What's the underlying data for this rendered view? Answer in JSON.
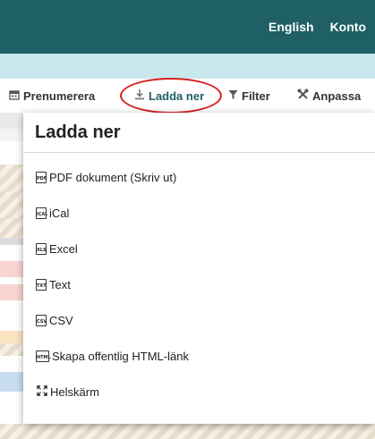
{
  "topbar": {
    "links": [
      "English",
      "Konto"
    ],
    "bg_color": "#1f5f66",
    "subbar_color": "#c9e8ee"
  },
  "toolbar": {
    "items": [
      {
        "label": "Prenumerera",
        "icon": "calendar-icon"
      },
      {
        "label": "Ladda ner",
        "icon": "download-icon"
      },
      {
        "label": "Filter",
        "icon": "filter-icon"
      },
      {
        "label": "Anpassa",
        "icon": "tools-icon"
      }
    ],
    "active_index": 1,
    "highlight_color": "#d81e1e"
  },
  "download_panel": {
    "title": "Ladda ner",
    "items": [
      {
        "label": "PDF dokument (Skriv ut)",
        "icon": "pdf-file-icon",
        "tag": "PDF"
      },
      {
        "label": "iCal",
        "icon": "ical-file-icon",
        "tag": "iCAL"
      },
      {
        "label": "Excel",
        "icon": "excel-file-icon",
        "tag": "XLS"
      },
      {
        "label": "Text",
        "icon": "text-file-icon",
        "tag": "TXT"
      },
      {
        "label": "CSV",
        "icon": "csv-file-icon",
        "tag": "CSV"
      },
      {
        "label": "Skapa offentlig HTML-länk",
        "icon": "html-file-icon",
        "tag": "HTML"
      },
      {
        "label": "Helskärm",
        "icon": "fullscreen-icon",
        "tag": ""
      }
    ]
  }
}
